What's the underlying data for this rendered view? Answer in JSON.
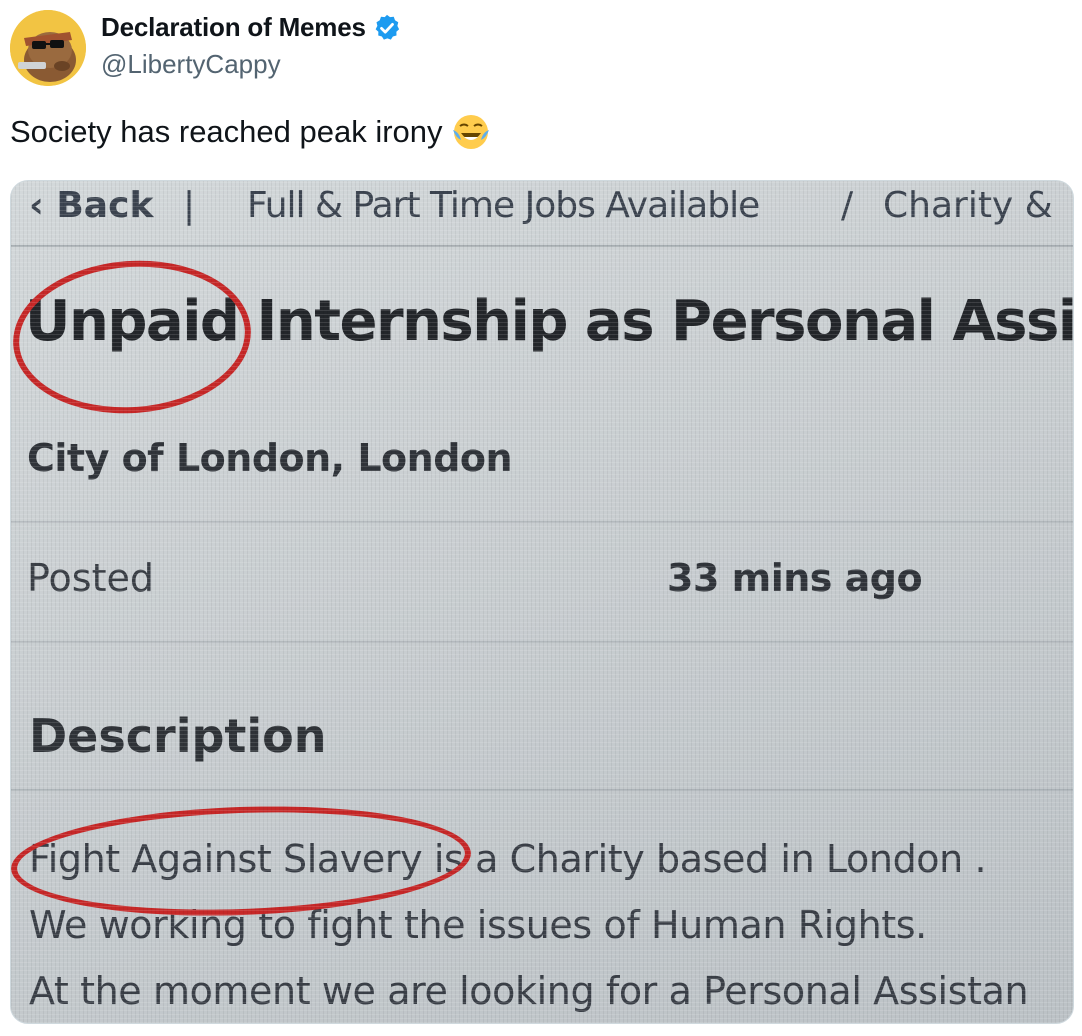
{
  "author": {
    "display_name": "Declaration of Memes",
    "handle": "@LibertyCappy",
    "avatar_icon": "cartoon-capybara-avatar",
    "verified_icon": "verified-badge-icon"
  },
  "tweet": {
    "text": "Society has reached peak irony",
    "emoji_icon": "face-with-tears-of-joy-emoji"
  },
  "photo": {
    "breadcrumb_back": "‹ Back",
    "breadcrumb_sep": "|",
    "breadcrumb_jobs": "Full & Part Time Jobs Available",
    "breadcrumb_slash": "/",
    "breadcrumb_charity": "Charity &",
    "title": "Unpaid Internship as Personal Assistan",
    "location": "City of London, London",
    "posted_label": "Posted",
    "posted_value": "33 mins ago",
    "description_heading": "Description",
    "description_lines": [
      "Fight Against Slavery is a Charity based in London .",
      "We working to fight the issues of Human Rights.",
      "At the moment we are looking for a Personal Assistan"
    ],
    "highlight_color": "#c62828"
  }
}
